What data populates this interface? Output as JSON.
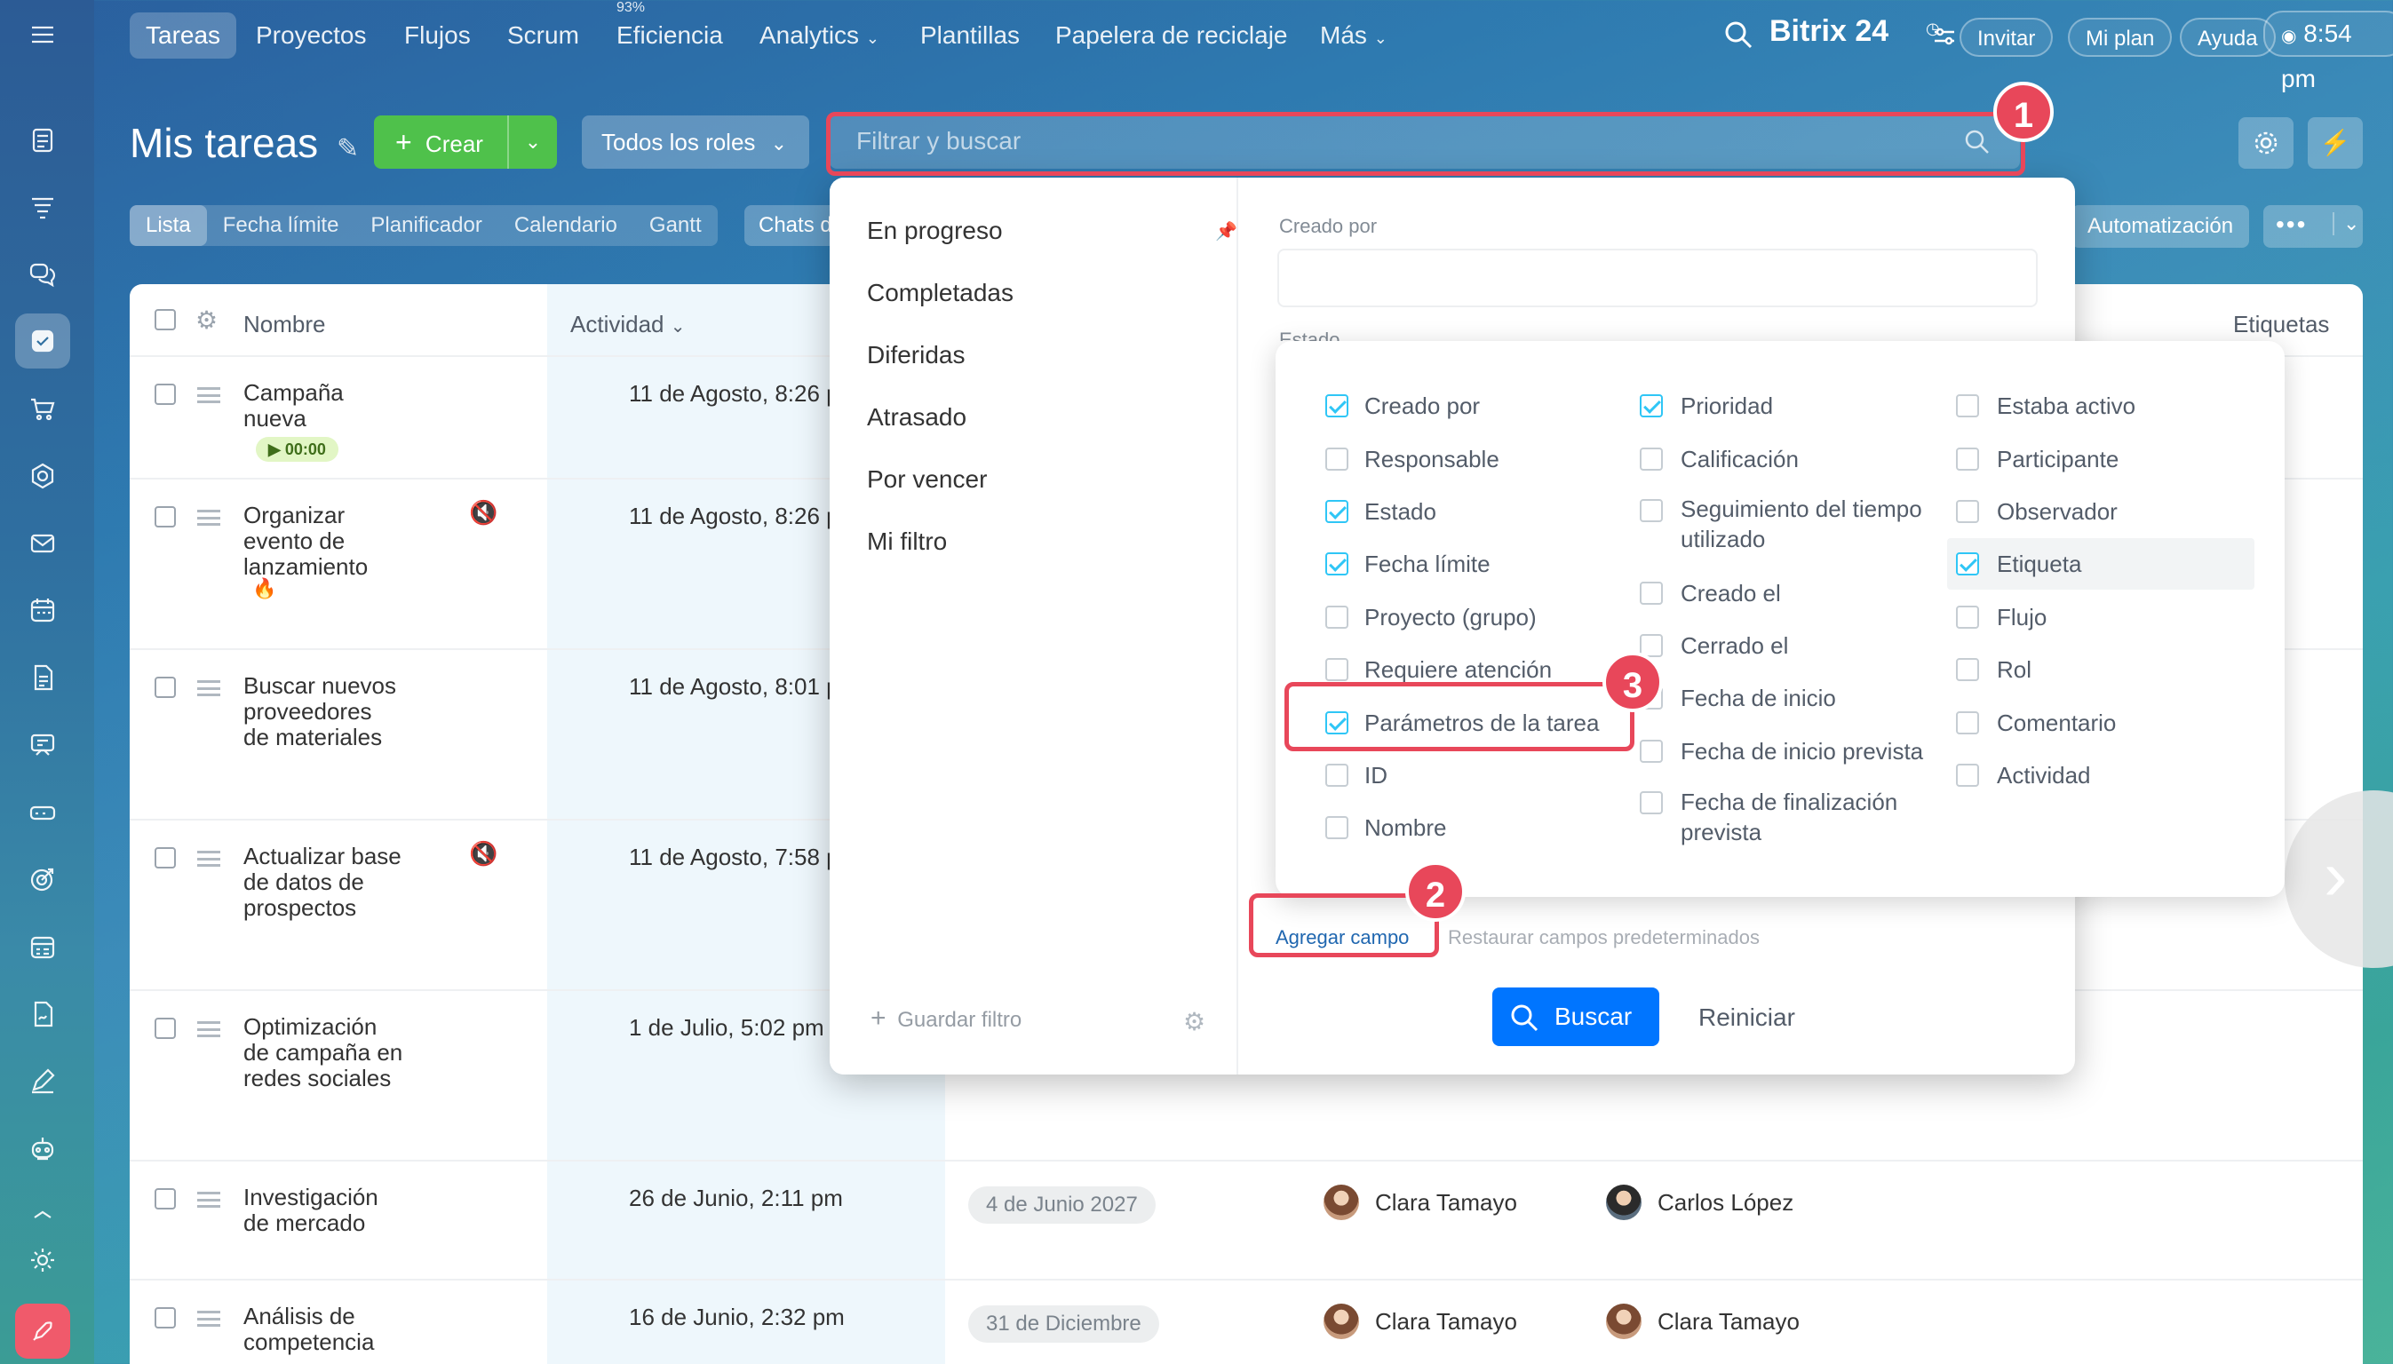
{
  "topnav": {
    "items": [
      "Tareas",
      "Proyectos",
      "Flujos",
      "Scrum",
      "Eficiencia",
      "Analytics",
      "Plantillas",
      "Papelera de reciclaje",
      "Más"
    ],
    "efficiency_badge": "93%",
    "brand": "Bitrix 24",
    "invite": "Invitar",
    "my_plan": "Mi plan",
    "help": "Ayuda",
    "clock": "8:54 pm"
  },
  "header": {
    "title": "Mis tareas",
    "create": "Crear",
    "roles": "Todos los roles",
    "search_placeholder": "Filtrar y buscar",
    "automation": "Automatización"
  },
  "view_tabs": [
    "Lista",
    "Fecha límite",
    "Planificador",
    "Calendario",
    "Gantt"
  ],
  "chats_tab": "Chats d",
  "table": {
    "headers": {
      "name": "Nombre",
      "activity": "Actividad",
      "tags": "Etiquetas"
    },
    "rows": [
      {
        "name": "Campaña nueva",
        "timer": "00:00",
        "activity": "11 de Agosto, 8:26 p"
      },
      {
        "name": "Organizar evento de lanzamiento",
        "activity": "11 de Agosto, 8:26 p"
      },
      {
        "name": "Buscar nuevos proveedores de materiales",
        "activity": "11 de Agosto, 8:01 p"
      },
      {
        "name": "Actualizar base de datos de prospectos",
        "activity": "11 de Agosto, 7:58 p"
      },
      {
        "name": "Optimización de campaña en redes sociales",
        "activity": "1 de Julio, 5:02 pm"
      },
      {
        "name": "Investigación de mercado",
        "activity": "26 de Junio, 2:11 pm",
        "deadline": "4 de Junio 2027",
        "creator": "Clara Tamayo",
        "responsible": "Carlos López"
      },
      {
        "name": "Análisis de competencia",
        "activity": "16 de Junio, 2:32 pm",
        "deadline": "31 de Diciembre",
        "creator": "Clara Tamayo",
        "responsible": "Clara Tamayo"
      }
    ]
  },
  "filter": {
    "presets": [
      "En progreso",
      "Completadas",
      "Diferidas",
      "Atrasado",
      "Por vencer",
      "Mi filtro"
    ],
    "save_filter": "Guardar filtro",
    "created_by_label": "Creado por",
    "status_label_partial": "Estado",
    "add_field": "Agregar campo",
    "restore_fields": "Restaurar campos predeterminados",
    "search_button": "Buscar",
    "reset_button": "Reiniciar"
  },
  "fields": {
    "col1": [
      {
        "label": "Creado por",
        "checked": true
      },
      {
        "label": "Responsable",
        "checked": false
      },
      {
        "label": "Estado",
        "checked": true
      },
      {
        "label": "Fecha límite",
        "checked": true
      },
      {
        "label": "Proyecto (grupo)",
        "checked": false
      },
      {
        "label": "Requiere atención",
        "checked": false
      },
      {
        "label": "Parámetros de la tarea",
        "checked": true
      },
      {
        "label": "ID",
        "checked": false
      },
      {
        "label": "Nombre",
        "checked": false
      }
    ],
    "col2": [
      {
        "label": "Prioridad",
        "checked": true
      },
      {
        "label": "Calificación",
        "checked": false
      },
      {
        "label": "Seguimiento del tiempo utilizado",
        "checked": false
      },
      {
        "label": "Creado el",
        "checked": false
      },
      {
        "label": "Cerrado el",
        "checked": false
      },
      {
        "label": "Fecha de inicio",
        "checked": false
      },
      {
        "label": "Fecha de inicio prevista",
        "checked": false
      },
      {
        "label": "Fecha de finalización prevista",
        "checked": false
      }
    ],
    "col3": [
      {
        "label": "Estaba activo",
        "checked": false
      },
      {
        "label": "Participante",
        "checked": false
      },
      {
        "label": "Observador",
        "checked": false
      },
      {
        "label": "Etiqueta",
        "checked": true
      },
      {
        "label": "Flujo",
        "checked": false
      },
      {
        "label": "Rol",
        "checked": false
      },
      {
        "label": "Comentario",
        "checked": false
      },
      {
        "label": "Actividad",
        "checked": false
      }
    ]
  },
  "callouts": [
    "1",
    "2",
    "3"
  ],
  "colors": {
    "accent": "#2fc6f6",
    "create": "#4fc14b",
    "search": "#0075ff",
    "callout": "#e8475a"
  }
}
